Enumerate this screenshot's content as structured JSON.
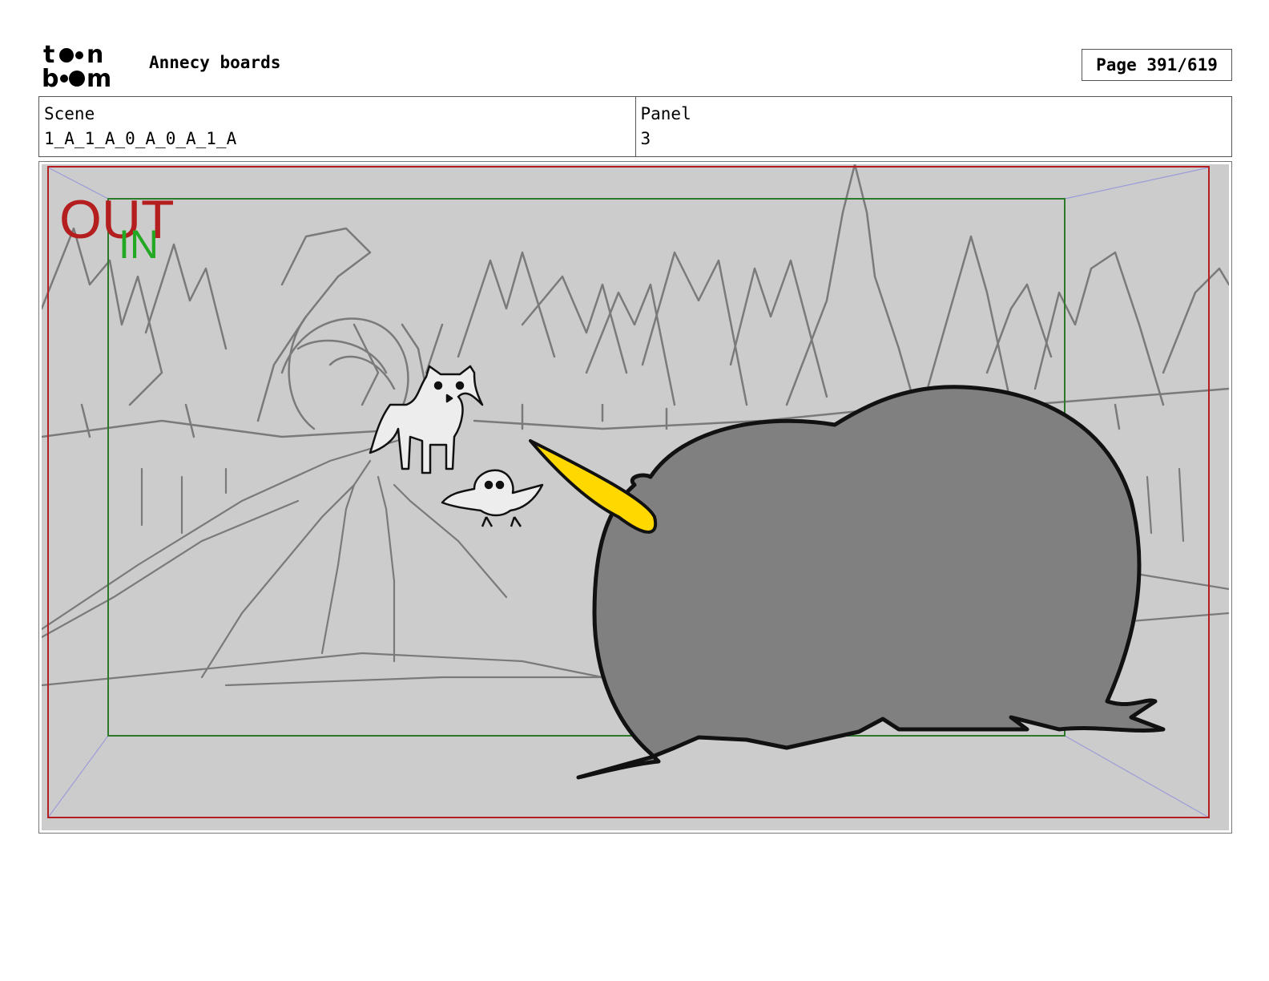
{
  "header": {
    "logo_text_top": "toon",
    "logo_text_bottom": "boom",
    "document_title": "Annecy boards",
    "page_indicator": "Page 391/619"
  },
  "info": {
    "scene_label": "Scene",
    "scene_value": "1_A_1_A_0_A_0_A_1_A",
    "panel_label": "Panel",
    "panel_value": "3"
  },
  "panel": {
    "out_label": "OUT",
    "in_label": "IN",
    "colors": {
      "out_frame": "#b41e1e",
      "in_frame": "#2a7a2a",
      "beak": "#ffd800",
      "creature_body": "#808080",
      "background": "#cccccc"
    }
  }
}
